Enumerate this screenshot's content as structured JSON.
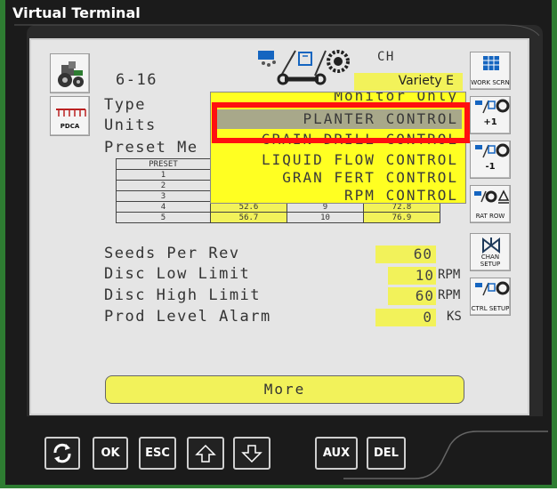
{
  "window": {
    "title": "Virtual Terminal"
  },
  "header": {
    "screen_code": "6-16",
    "channel": "CH",
    "variety": "Variety E"
  },
  "left_keys": [
    {
      "icon": "tractor-icon",
      "label": ""
    },
    {
      "icon": "planter-icon",
      "label": "PDCA"
    }
  ],
  "right_keys": [
    {
      "icon": "grid-screen-icon",
      "label": "WORK SCRN"
    },
    {
      "icon": "seed-meter-icon",
      "label": "+1"
    },
    {
      "icon": "seed-meter-icon",
      "label": "-1"
    },
    {
      "icon": "rate-row-icon",
      "label": "RAT ROW"
    },
    {
      "icon": "channel-valve-icon",
      "label": "CHAN SETUP"
    },
    {
      "icon": "control-setup-icon",
      "label": "CTRL SETUP"
    }
  ],
  "form": {
    "type_label": "Type",
    "type_value": "Monitor Only",
    "units_label": "Units",
    "preset_label": "Preset Me",
    "preset_header": "PRESET",
    "preset_rows": [
      {
        "n": "1",
        "a": "",
        "b": "",
        "c": ""
      },
      {
        "n": "2",
        "a": "",
        "b": "",
        "c": ""
      },
      {
        "n": "3",
        "a": "",
        "b": "",
        "c": ""
      },
      {
        "n": "4",
        "a": "52.6",
        "b": "9",
        "c": "72.8"
      },
      {
        "n": "5",
        "a": "56.7",
        "b": "10",
        "c": "76.9"
      }
    ],
    "seeds_label": "Seeds Per Rev",
    "seeds_value": "60",
    "disc_low_label": "Disc Low Limit",
    "disc_low_value": "10",
    "disc_low_unit": "RPM",
    "disc_high_label": "Disc High Limit",
    "disc_high_value": "60",
    "disc_high_unit": "RPM",
    "prod_label": "Prod Level Alarm",
    "prod_value": "0",
    "prod_unit": "KS"
  },
  "dropdown": {
    "items": [
      "Monitor Only",
      "PLANTER CONTROL",
      "GRAIN DRILL CONTROL",
      "LIQUID FLOW CONTROL",
      "GRAN FERT CONTROL",
      "RPM CONTROL"
    ],
    "selected": "PLANTER CONTROL"
  },
  "more_button": {
    "label": "More"
  },
  "bottom_bar": {
    "ok": "OK",
    "esc": "ESC",
    "aux": "AUX",
    "del": "DEL"
  },
  "colors": {
    "field_yellow": "#f2f25a",
    "dropdown_yellow": "#ffff22",
    "highlight_red": "#ff1010",
    "frame_green": "#2e7d32"
  }
}
